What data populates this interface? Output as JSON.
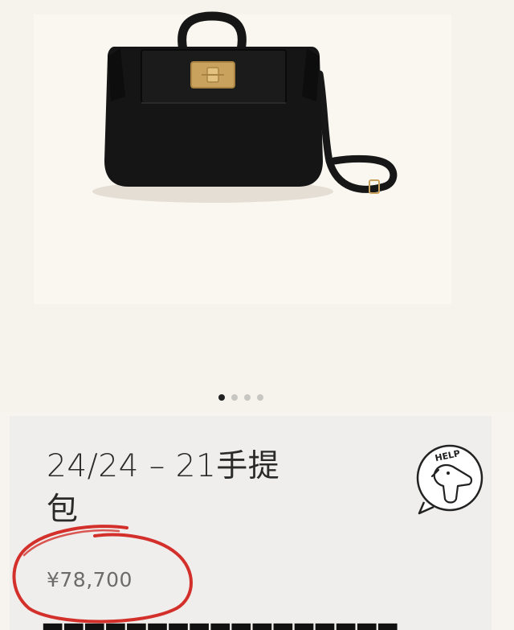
{
  "product": {
    "title_line1": "24/24 – 21手提",
    "title_line2": "包",
    "price": "¥78,700"
  },
  "help_badge": {
    "label": "HELP",
    "icon": "help-dog-icon"
  },
  "carousel": {
    "dot_count": 4,
    "active_index": 0
  },
  "colors": {
    "bag": "#141414",
    "clasp": "#c9a25e",
    "annotation": "#d4302b",
    "card": "#efeeec"
  }
}
